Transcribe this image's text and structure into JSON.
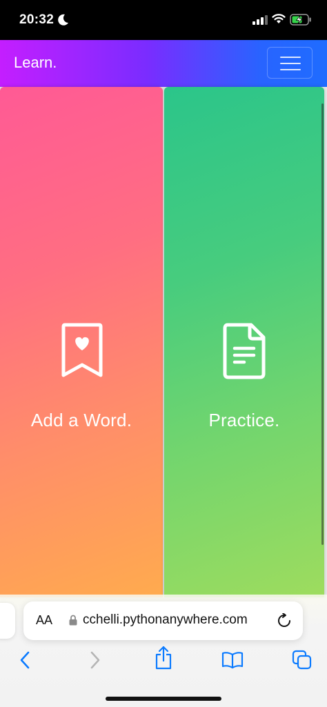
{
  "status_bar": {
    "time": "20:32",
    "icons": [
      "moon-icon",
      "signal-icon",
      "wifi-icon",
      "battery-charging-icon"
    ]
  },
  "navbar": {
    "brand": "Learn.",
    "menu_icon": "hamburger-menu-icon"
  },
  "cards": [
    {
      "title": "Add a Word.",
      "icon": "bookmark-heart-icon"
    },
    {
      "title": "Practice.",
      "icon": "document-text-icon"
    }
  ],
  "safari": {
    "aa_label": "AA",
    "url": "cchelli.pythonanywhere.com",
    "toolbar_icons": [
      "back-icon",
      "forward-icon",
      "share-icon",
      "bookmarks-icon",
      "tabs-icon"
    ]
  },
  "colors": {
    "navbar_start": "#c41eff",
    "navbar_end": "#1f6cff",
    "card_add_top": "#ff5a95",
    "card_add_bottom": "#ffab4e",
    "card_practice_top": "#2bc58a",
    "card_practice_bottom": "#9edc5e",
    "ios_blue": "#0a7aff"
  }
}
